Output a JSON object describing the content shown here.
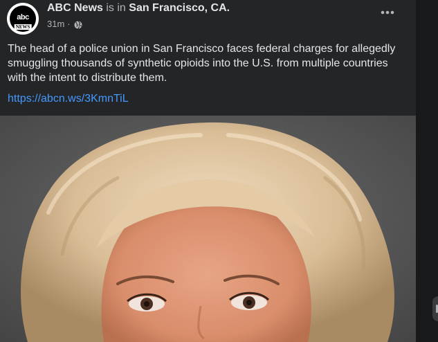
{
  "post": {
    "author": "ABC News",
    "is_in": "is in",
    "location": "San Francisco, CA.",
    "time": "31m",
    "dot": "·",
    "text": "The head of a police union in San Francisco faces federal charges for allegedly smuggling thousands of synthetic opioids into the U.S. from multiple countries with the intent to distribute them.",
    "link": "https://abcn.ws/3KmnTiL",
    "image_alt": "Portrait of a woman with blonde hair",
    "avatar": {
      "logo_text": "abc",
      "sub_text": "NEWS"
    },
    "privacy_icon": "globe-icon",
    "menu_icon": "more-horizontal-icon"
  },
  "colors": {
    "page_bg": "#18191a",
    "card_bg": "#242526",
    "primary_text": "#e4e6eb",
    "secondary_text": "#b0b3b8",
    "link": "#4599ff"
  }
}
